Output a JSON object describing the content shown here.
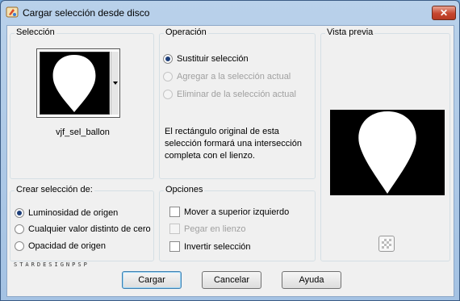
{
  "window": {
    "title": "Cargar selección desde disco",
    "close_glyph": "✕"
  },
  "seleccion": {
    "label": "Selección",
    "filename": "vjf_sel_ballon",
    "dropdown_icon": "chevron-down-icon"
  },
  "operacion": {
    "label": "Operación",
    "options": [
      {
        "label": "Sustituir selección",
        "selected": true,
        "enabled": true
      },
      {
        "label": "Agregar a la selección actual",
        "selected": false,
        "enabled": false
      },
      {
        "label": "Eliminar de la selección actual",
        "selected": false,
        "enabled": false
      }
    ],
    "description": "El rectángulo original de esta selección formará una intersección completa con el lienzo."
  },
  "vista_previa": {
    "label": "Vista previa",
    "checker_icon": "transparency-icon"
  },
  "crear": {
    "label": "Crear selección de:",
    "options": [
      {
        "label": "Luminosidad de origen",
        "selected": true
      },
      {
        "label": "Cualquier valor distinto de cero",
        "selected": false
      },
      {
        "label": "Opacidad de origen",
        "selected": false
      }
    ]
  },
  "opciones": {
    "label": "Opciones",
    "items": [
      {
        "label": "Mover a superior izquierdo",
        "checked": false,
        "enabled": true
      },
      {
        "label": "Pegar en lienzo",
        "checked": false,
        "enabled": false
      },
      {
        "label": "Invertir selección",
        "checked": false,
        "enabled": true
      }
    ]
  },
  "watermark": "STARDESIGNPSP",
  "buttons": {
    "cargar": "Cargar",
    "cancelar": "Cancelar",
    "ayuda": "Ayuda"
  },
  "colors": {
    "title_bg": "#b9d1ea",
    "close": "#c6462e",
    "radio_dot": "#1d3f7a"
  }
}
